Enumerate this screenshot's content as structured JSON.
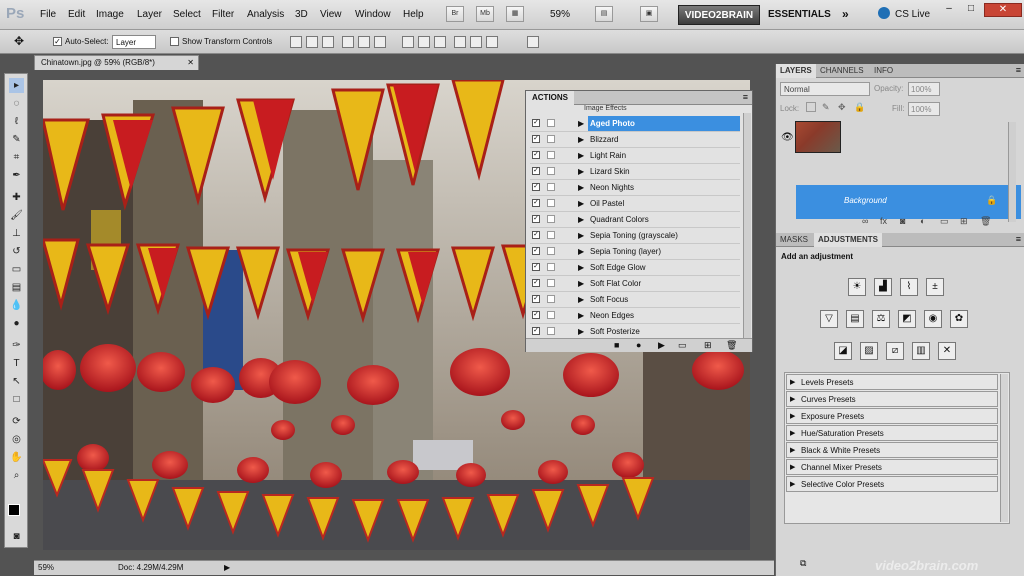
{
  "app": {
    "logo": "Ps"
  },
  "menu": [
    "File",
    "Edit",
    "Image",
    "Layer",
    "Select",
    "Filter",
    "Analysis",
    "3D",
    "View",
    "Window",
    "Help"
  ],
  "menubar": {
    "zoom": "59%",
    "workspace_btn": "VIDEO2BRAIN",
    "essentials": "ESSENTIALS",
    "cs_live": "CS Live"
  },
  "options": {
    "auto_select_label": "Auto-Select:",
    "auto_select_value": "Layer",
    "show_transform_label": "Show Transform Controls"
  },
  "document": {
    "tab_title": "Chinatown.jpg @ 59% (RGB/8*)",
    "zoom": "59%",
    "doc_info": "Doc: 4.29M/4.29M"
  },
  "actions_panel": {
    "tab": "ACTIONS",
    "group": "Image Effects",
    "items": [
      {
        "label": "Aged Photo",
        "selected": true
      },
      {
        "label": "Blizzard"
      },
      {
        "label": "Light Rain"
      },
      {
        "label": "Lizard Skin"
      },
      {
        "label": "Neon Nights"
      },
      {
        "label": "Oil Pastel"
      },
      {
        "label": "Quadrant Colors"
      },
      {
        "label": "Sepia Toning (grayscale)"
      },
      {
        "label": "Sepia Toning (layer)"
      },
      {
        "label": "Soft Edge Glow"
      },
      {
        "label": "Soft Flat Color"
      },
      {
        "label": "Soft Focus"
      },
      {
        "label": "Neon Edges"
      },
      {
        "label": "Soft Posterize"
      }
    ]
  },
  "layers_panel": {
    "tabs": [
      "LAYERS",
      "CHANNELS",
      "INFO"
    ],
    "blend_mode": "Normal",
    "opacity_label": "Opacity:",
    "opacity": "100%",
    "lock_label": "Lock:",
    "fill_label": "Fill:",
    "fill": "100%",
    "layer_name": "Background"
  },
  "adjustments_panel": {
    "tabs": [
      "MASKS",
      "ADJUSTMENTS"
    ],
    "heading": "Add an adjustment",
    "presets": [
      "Levels Presets",
      "Curves Presets",
      "Exposure Presets",
      "Hue/Saturation Presets",
      "Black & White Presets",
      "Channel Mixer Presets",
      "Selective Color Presets"
    ]
  },
  "watermark": "video2brain.com",
  "colors": {
    "selection": "#3b8fe0",
    "ui_bg": "#d6d6d6",
    "accent_red": "#c84535"
  }
}
